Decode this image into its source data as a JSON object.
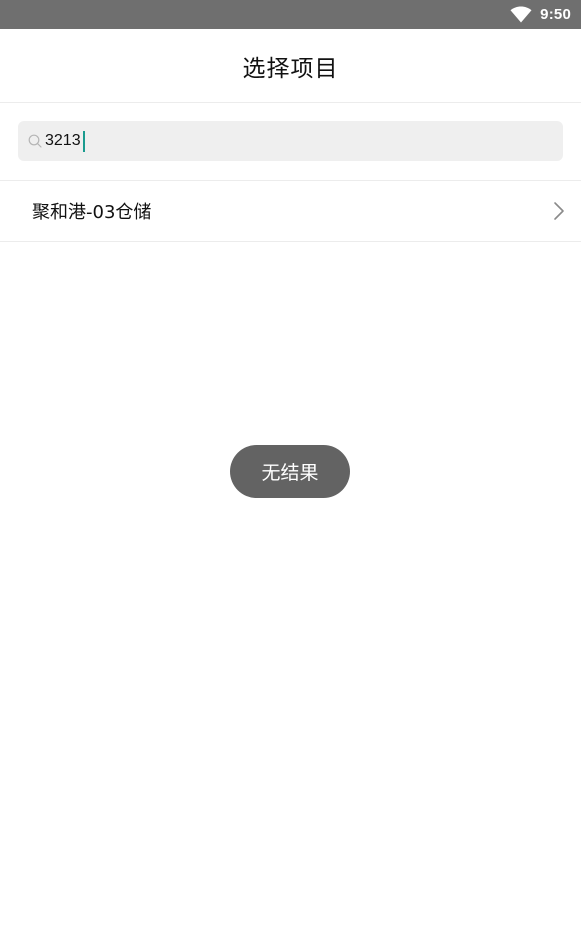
{
  "status_bar": {
    "time": "9:50",
    "wifi_icon": "wifi-icon",
    "background_color": "#6f6f6f"
  },
  "header": {
    "title": "选择项目"
  },
  "search": {
    "icon": "search-icon",
    "value": "3213",
    "caret_color": "#1a9b8f",
    "field_background": "#efefef"
  },
  "results": [
    {
      "label": "聚和港-03仓储",
      "icon": "chevron-right-icon"
    }
  ],
  "toast": {
    "text": "无结果",
    "background_color": "#636363"
  }
}
